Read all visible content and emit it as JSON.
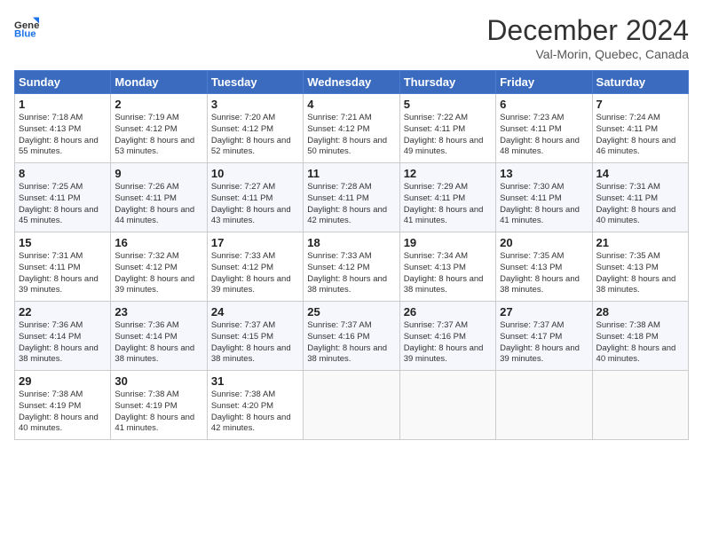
{
  "header": {
    "logo_general": "General",
    "logo_blue": "Blue",
    "month_title": "December 2024",
    "location": "Val-Morin, Quebec, Canada"
  },
  "days_of_week": [
    "Sunday",
    "Monday",
    "Tuesday",
    "Wednesday",
    "Thursday",
    "Friday",
    "Saturday"
  ],
  "weeks": [
    [
      {
        "day": "1",
        "sunrise": "7:18 AM",
        "sunset": "4:13 PM",
        "daylight": "8 hours and 55 minutes."
      },
      {
        "day": "2",
        "sunrise": "7:19 AM",
        "sunset": "4:12 PM",
        "daylight": "8 hours and 53 minutes."
      },
      {
        "day": "3",
        "sunrise": "7:20 AM",
        "sunset": "4:12 PM",
        "daylight": "8 hours and 52 minutes."
      },
      {
        "day": "4",
        "sunrise": "7:21 AM",
        "sunset": "4:12 PM",
        "daylight": "8 hours and 50 minutes."
      },
      {
        "day": "5",
        "sunrise": "7:22 AM",
        "sunset": "4:11 PM",
        "daylight": "8 hours and 49 minutes."
      },
      {
        "day": "6",
        "sunrise": "7:23 AM",
        "sunset": "4:11 PM",
        "daylight": "8 hours and 48 minutes."
      },
      {
        "day": "7",
        "sunrise": "7:24 AM",
        "sunset": "4:11 PM",
        "daylight": "8 hours and 46 minutes."
      }
    ],
    [
      {
        "day": "8",
        "sunrise": "7:25 AM",
        "sunset": "4:11 PM",
        "daylight": "8 hours and 45 minutes."
      },
      {
        "day": "9",
        "sunrise": "7:26 AM",
        "sunset": "4:11 PM",
        "daylight": "8 hours and 44 minutes."
      },
      {
        "day": "10",
        "sunrise": "7:27 AM",
        "sunset": "4:11 PM",
        "daylight": "8 hours and 43 minutes."
      },
      {
        "day": "11",
        "sunrise": "7:28 AM",
        "sunset": "4:11 PM",
        "daylight": "8 hours and 42 minutes."
      },
      {
        "day": "12",
        "sunrise": "7:29 AM",
        "sunset": "4:11 PM",
        "daylight": "8 hours and 41 minutes."
      },
      {
        "day": "13",
        "sunrise": "7:30 AM",
        "sunset": "4:11 PM",
        "daylight": "8 hours and 41 minutes."
      },
      {
        "day": "14",
        "sunrise": "7:31 AM",
        "sunset": "4:11 PM",
        "daylight": "8 hours and 40 minutes."
      }
    ],
    [
      {
        "day": "15",
        "sunrise": "7:31 AM",
        "sunset": "4:11 PM",
        "daylight": "8 hours and 39 minutes."
      },
      {
        "day": "16",
        "sunrise": "7:32 AM",
        "sunset": "4:12 PM",
        "daylight": "8 hours and 39 minutes."
      },
      {
        "day": "17",
        "sunrise": "7:33 AM",
        "sunset": "4:12 PM",
        "daylight": "8 hours and 39 minutes."
      },
      {
        "day": "18",
        "sunrise": "7:33 AM",
        "sunset": "4:12 PM",
        "daylight": "8 hours and 38 minutes."
      },
      {
        "day": "19",
        "sunrise": "7:34 AM",
        "sunset": "4:13 PM",
        "daylight": "8 hours and 38 minutes."
      },
      {
        "day": "20",
        "sunrise": "7:35 AM",
        "sunset": "4:13 PM",
        "daylight": "8 hours and 38 minutes."
      },
      {
        "day": "21",
        "sunrise": "7:35 AM",
        "sunset": "4:13 PM",
        "daylight": "8 hours and 38 minutes."
      }
    ],
    [
      {
        "day": "22",
        "sunrise": "7:36 AM",
        "sunset": "4:14 PM",
        "daylight": "8 hours and 38 minutes."
      },
      {
        "day": "23",
        "sunrise": "7:36 AM",
        "sunset": "4:14 PM",
        "daylight": "8 hours and 38 minutes."
      },
      {
        "day": "24",
        "sunrise": "7:37 AM",
        "sunset": "4:15 PM",
        "daylight": "8 hours and 38 minutes."
      },
      {
        "day": "25",
        "sunrise": "7:37 AM",
        "sunset": "4:16 PM",
        "daylight": "8 hours and 38 minutes."
      },
      {
        "day": "26",
        "sunrise": "7:37 AM",
        "sunset": "4:16 PM",
        "daylight": "8 hours and 39 minutes."
      },
      {
        "day": "27",
        "sunrise": "7:37 AM",
        "sunset": "4:17 PM",
        "daylight": "8 hours and 39 minutes."
      },
      {
        "day": "28",
        "sunrise": "7:38 AM",
        "sunset": "4:18 PM",
        "daylight": "8 hours and 40 minutes."
      }
    ],
    [
      {
        "day": "29",
        "sunrise": "7:38 AM",
        "sunset": "4:19 PM",
        "daylight": "8 hours and 40 minutes."
      },
      {
        "day": "30",
        "sunrise": "7:38 AM",
        "sunset": "4:19 PM",
        "daylight": "8 hours and 41 minutes."
      },
      {
        "day": "31",
        "sunrise": "7:38 AM",
        "sunset": "4:20 PM",
        "daylight": "8 hours and 42 minutes."
      },
      null,
      null,
      null,
      null
    ]
  ]
}
